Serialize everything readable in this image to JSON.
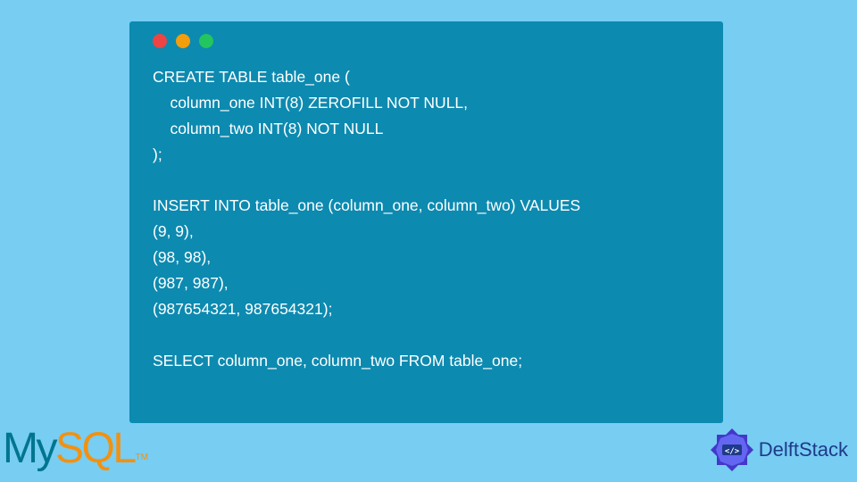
{
  "code": {
    "lines": [
      "CREATE TABLE table_one (",
      "    column_one INT(8) ZEROFILL NOT NULL,",
      "    column_two INT(8) NOT NULL",
      ");",
      "",
      "INSERT INTO table_one (column_one, column_two) VALUES",
      "(9, 9),",
      "(98, 98),",
      "(987, 987),",
      "(987654321, 987654321);",
      "",
      "SELECT column_one, column_two FROM table_one;"
    ]
  },
  "logos": {
    "mysql": {
      "part1": "My",
      "part2": "SQL",
      "trademark": "TM"
    },
    "delftstack": {
      "text": "DelftStack"
    }
  }
}
